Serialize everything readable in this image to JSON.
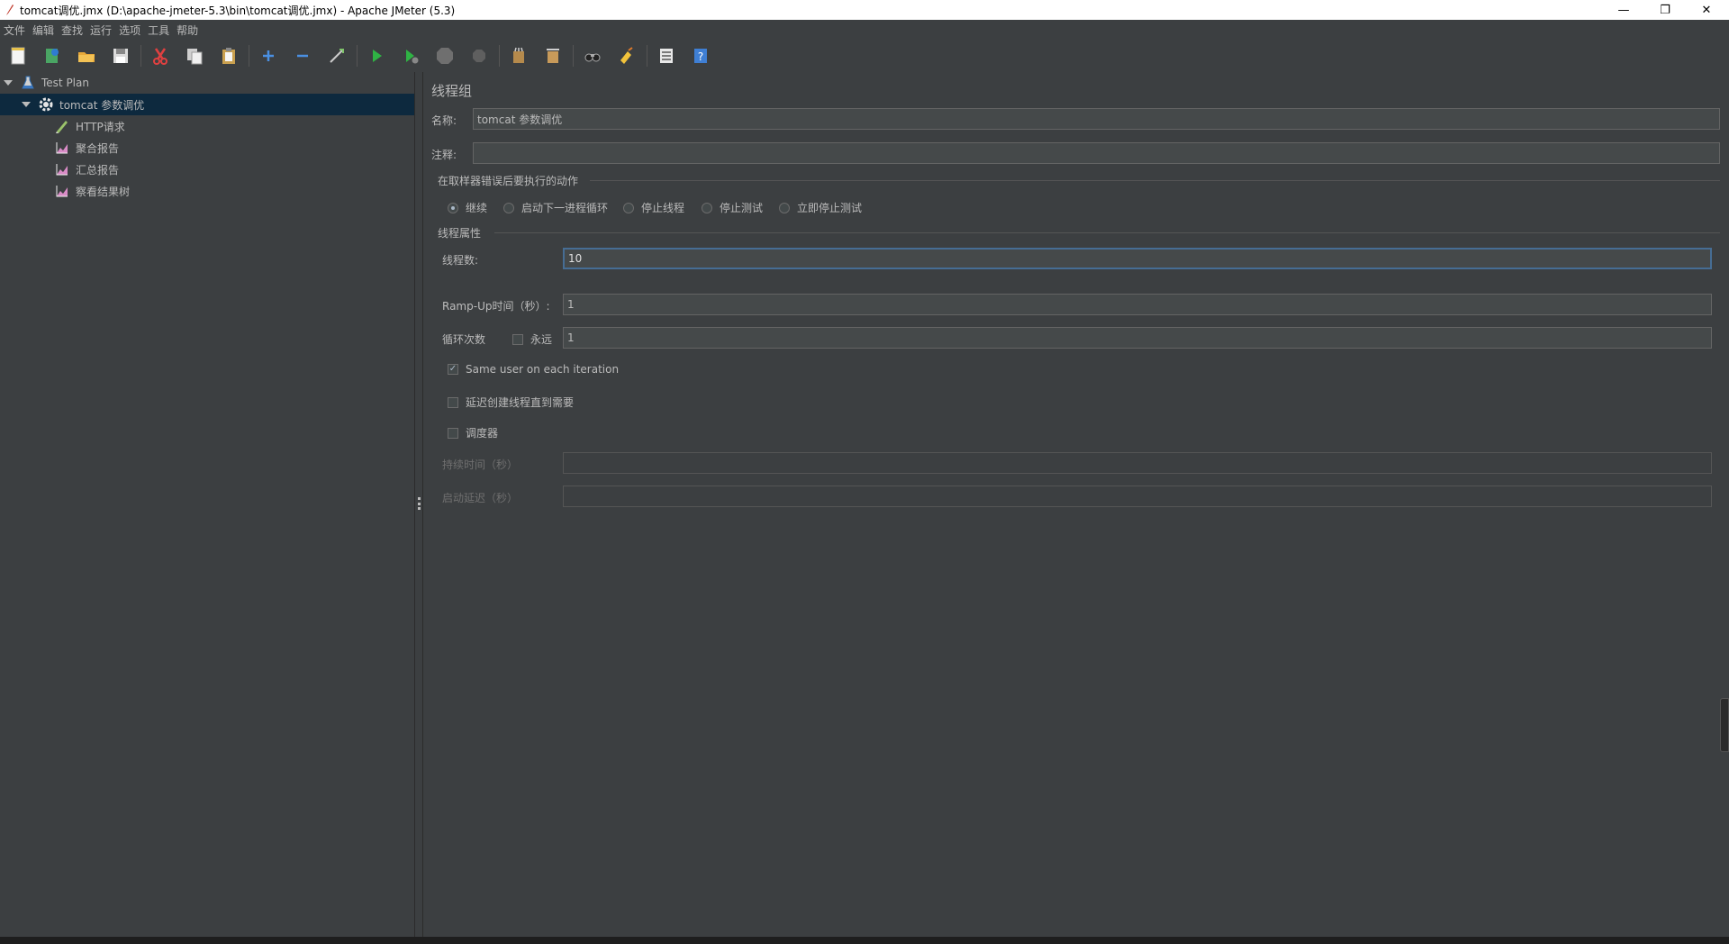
{
  "window": {
    "title": "tomcat调优.jmx (D:\\apache-jmeter-5.3\\bin\\tomcat调优.jmx) - Apache JMeter (5.3)",
    "minimize": "—",
    "maximize": "❐",
    "close": "✕"
  },
  "menu": [
    "文件",
    "编辑",
    "查找",
    "运行",
    "选项",
    "工具",
    "帮助"
  ],
  "toolbar": [
    "new",
    "templates",
    "open",
    "save",
    "cut",
    "copy",
    "paste",
    "expand",
    "collapse",
    "toggle",
    "start",
    "start-no-pauses",
    "stop",
    "shutdown",
    "clear",
    "clear-all",
    "search",
    "reset-search",
    "function-helper",
    "help"
  ],
  "tree": {
    "root": "Test Plan",
    "thread_group": "tomcat 参数调优",
    "children": [
      "HTTP请求",
      "聚合报告",
      "汇总报告",
      "察看结果树"
    ]
  },
  "panel": {
    "title": "线程组",
    "name_label": "名称:",
    "name_value": "tomcat 参数调优",
    "comment_label": "注释:",
    "comment_value": "",
    "error_section": "在取样器错误后要执行的动作",
    "error_options": [
      "继续",
      "启动下一进程循环",
      "停止线程",
      "停止测试",
      "立即停止测试"
    ],
    "error_selected": "继续",
    "thread_section": "线程属性",
    "threads_label": "线程数:",
    "threads_value": "10",
    "rampup_label": "Ramp-Up时间（秒）:",
    "rampup_value": "1",
    "loop_label": "循环次数",
    "forever_label": "永远",
    "loop_value": "1",
    "same_user_label": "Same user on each iteration",
    "delay_label": "延迟创建线程直到需要",
    "scheduler_label": "调度器",
    "duration_label": "持续时间（秒）",
    "duration_value": "",
    "startup_delay_label": "启动延迟（秒）",
    "startup_delay_value": ""
  },
  "colors": {
    "background": "#3c3f41",
    "selected": "#0d293e",
    "focus": "#466d94"
  }
}
